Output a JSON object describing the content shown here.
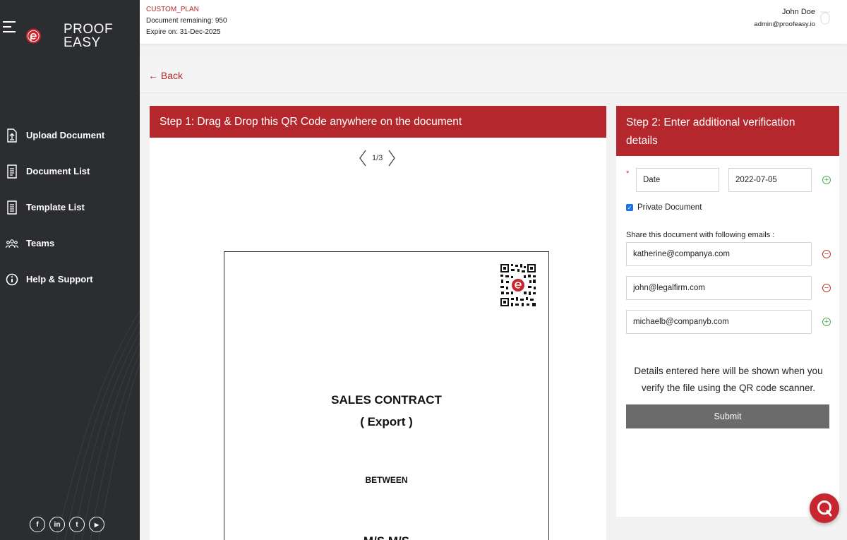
{
  "brand": {
    "logo_text_line1": "PROOF",
    "logo_text_line2": "EASY",
    "accent": "#b3272d"
  },
  "sidebar": {
    "items": [
      {
        "label": "Upload Document",
        "icon": "upload-file-icon"
      },
      {
        "label": "Document List",
        "icon": "document-icon"
      },
      {
        "label": "Template List",
        "icon": "template-icon"
      },
      {
        "label": "Teams",
        "icon": "teams-icon"
      },
      {
        "label": "Help & Support",
        "icon": "info-icon"
      }
    ],
    "social": [
      {
        "glyph": "f",
        "icon": "facebook-icon"
      },
      {
        "glyph": "in",
        "icon": "linkedin-icon"
      },
      {
        "glyph": "t",
        "icon": "twitter-icon"
      },
      {
        "glyph": "▶",
        "icon": "youtube-icon"
      }
    ]
  },
  "header": {
    "plan_name": "CUSTOM_PLAN",
    "documents_remaining": "Document remaining: 950",
    "expiry": "Expire on: 31-Dec-2025",
    "user_name": "John Doe",
    "user_email": "admin@proofeasy.io"
  },
  "back_label": "← Back",
  "step1": {
    "title": "Step 1: Drag & Drop this QR Code anywhere on the document",
    "page_indicator": "1/3",
    "document": {
      "title": "SALES CONTRACT",
      "subtitle": "( Export )",
      "between": "BETWEEN",
      "party_partial": "M/S M/S"
    }
  },
  "step2": {
    "title": "Step 2: Enter additional verification details",
    "required_mark": "*",
    "field_key": "Date",
    "field_value": "2022-07-05",
    "private_label": "Private Document",
    "private_checked": true,
    "share_label": "Share this document with following emails :",
    "emails": [
      "katherine@companya.com",
      "john@legalfirm.com",
      "michaelb@companyb.com"
    ],
    "info_text": "Details entered here will be shown when you verify the file using the QR code scanner.",
    "submit_label": "Submit"
  }
}
